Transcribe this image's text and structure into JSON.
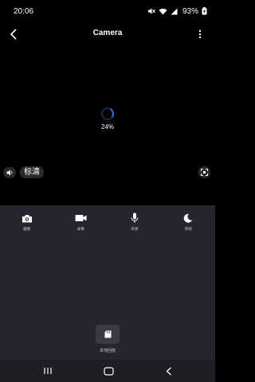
{
  "status_bar": {
    "time": "20:06",
    "battery_percent": "93%",
    "icons": [
      "mute-icon",
      "wifi-icon",
      "signal-icon",
      "battery-icon"
    ]
  },
  "header": {
    "title": "Camera",
    "back_icon": "chevron-left-icon",
    "more_icon": "more-vertical-icon"
  },
  "video": {
    "loading_progress": "24%",
    "loading_fraction": 0.24,
    "quality_label": "标清",
    "volume_icon": "volume-icon",
    "fullscreen_icon": "fullscreen-icon"
  },
  "controls": [
    {
      "id": "snapshot",
      "label": "截图",
      "icon": "camera-icon"
    },
    {
      "id": "record",
      "label": "录像",
      "icon": "video-camera-icon"
    },
    {
      "id": "talk",
      "label": "对讲",
      "icon": "microphone-icon"
    },
    {
      "id": "night",
      "label": "夜视",
      "icon": "moon-icon"
    }
  ],
  "playback": {
    "label": "本地回放",
    "icon": "sd-card-icon"
  },
  "nav": {
    "recents_icon": "recents-icon",
    "home_icon": "home-icon",
    "back_icon": "back-icon"
  },
  "colors": {
    "accent": "#2f6bdc",
    "panel_bg": "#25252d",
    "video_bg": "#000000"
  }
}
